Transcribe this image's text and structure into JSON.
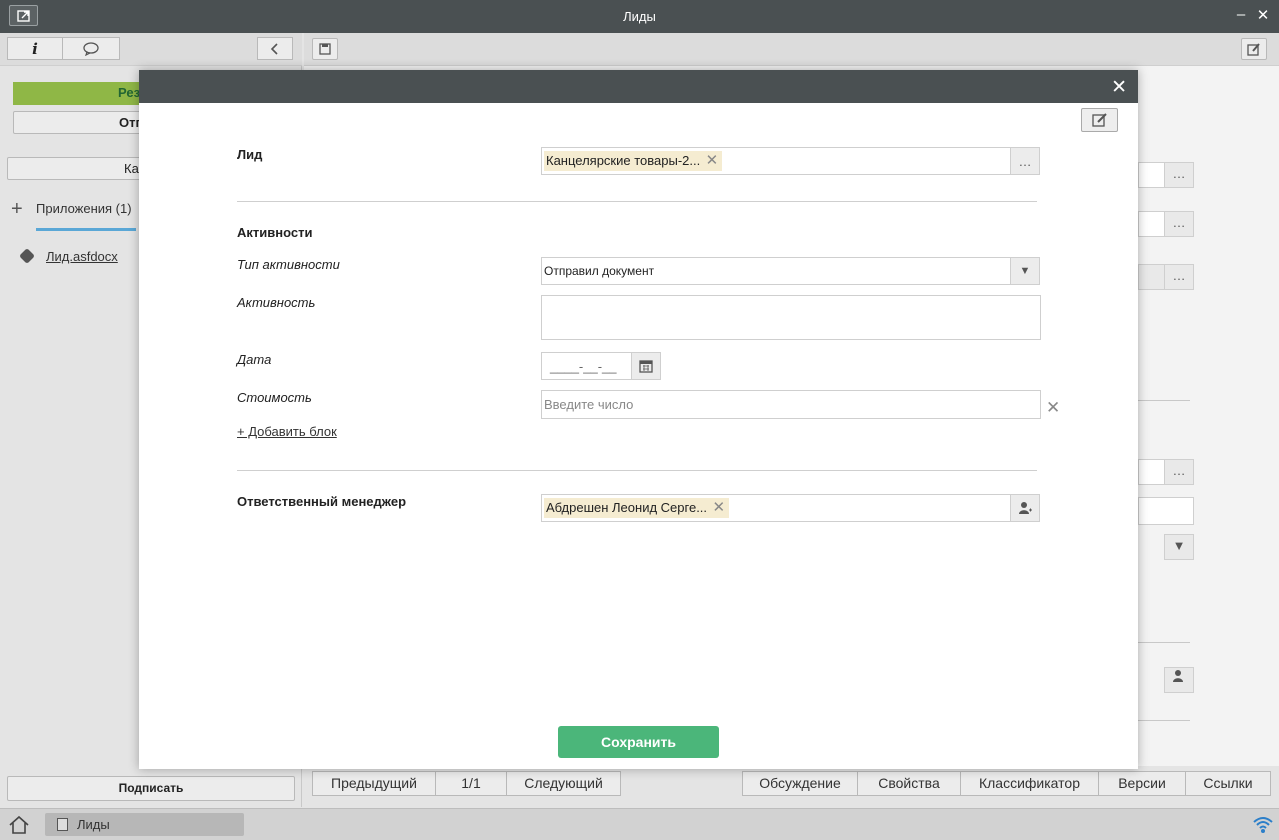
{
  "window": {
    "title": "Лиды"
  },
  "left_panel": {
    "green_button": "Резу",
    "second_button": "Отп",
    "third_button": "Ка",
    "attachments_tab": "Приложения (1)",
    "file_name": "Лид.asfdocx",
    "sign_button": "Подписать"
  },
  "bottom_nav": {
    "prev": "Предыдущий",
    "page": "1/1",
    "next": "Следующий",
    "discussion": "Обсуждение",
    "properties": "Свойства",
    "classifier": "Классификатор",
    "versions": "Версии",
    "links": "Ссылки"
  },
  "taskbar": {
    "item": "Лиды"
  },
  "modal": {
    "lead_label": "Лид",
    "lead_value": "Канцелярские товары-2...",
    "activities_heading": "Активности",
    "activity_type_label": "Тип активности",
    "activity_type_value": "Отправил документ",
    "activity_label": "Активность",
    "activity_value": "",
    "date_label": "Дата",
    "date_placeholder": "____-__-__",
    "cost_label": "Стоимость",
    "cost_placeholder": "Введите число",
    "add_block": "+ Добавить блок",
    "manager_label": "Ответственный менеджер",
    "manager_value": "Абдрешен Леонид Серге...",
    "save_button": "Сохранить"
  },
  "colors": {
    "titlebar": "#4a5052",
    "green_accent": "#8fb746",
    "save_button": "#4bb67a",
    "tag_bg": "#f5ecd1"
  }
}
